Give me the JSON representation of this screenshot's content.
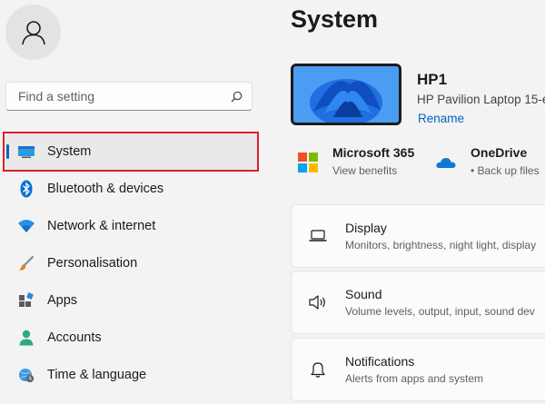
{
  "sidebar": {
    "search": {
      "placeholder": "Find a setting"
    },
    "items": [
      {
        "label": "System",
        "icon": "monitor-icon",
        "selected": true
      },
      {
        "label": "Bluetooth & devices",
        "icon": "bluetooth-icon"
      },
      {
        "label": "Network & internet",
        "icon": "wifi-icon"
      },
      {
        "label": "Personalisation",
        "icon": "paintbrush-icon"
      },
      {
        "label": "Apps",
        "icon": "apps-icon"
      },
      {
        "label": "Accounts",
        "icon": "person-icon"
      },
      {
        "label": "Time & language",
        "icon": "globe-clock-icon"
      }
    ]
  },
  "main": {
    "title": "System",
    "device": {
      "name": "HP1",
      "model": "HP Pavilion Laptop 15-e",
      "rename_label": "Rename"
    },
    "promos": [
      {
        "title": "Microsoft 365",
        "subtitle": "View benefits",
        "icon": "microsoft-logo-icon"
      },
      {
        "title": "OneDrive",
        "subtitle": "• Back up files",
        "icon": "onedrive-cloud-icon"
      }
    ],
    "cards": [
      {
        "title": "Display",
        "subtitle": "Monitors, brightness, night light, display",
        "icon": "laptop-icon"
      },
      {
        "title": "Sound",
        "subtitle": "Volume levels, output, input, sound dev",
        "icon": "speaker-icon"
      },
      {
        "title": "Notifications",
        "subtitle": "Alerts from apps and system",
        "icon": "bell-icon"
      }
    ]
  },
  "colors": {
    "accent": "#0067c0",
    "highlight": "#d6202b",
    "background": "#f3f3f3"
  }
}
